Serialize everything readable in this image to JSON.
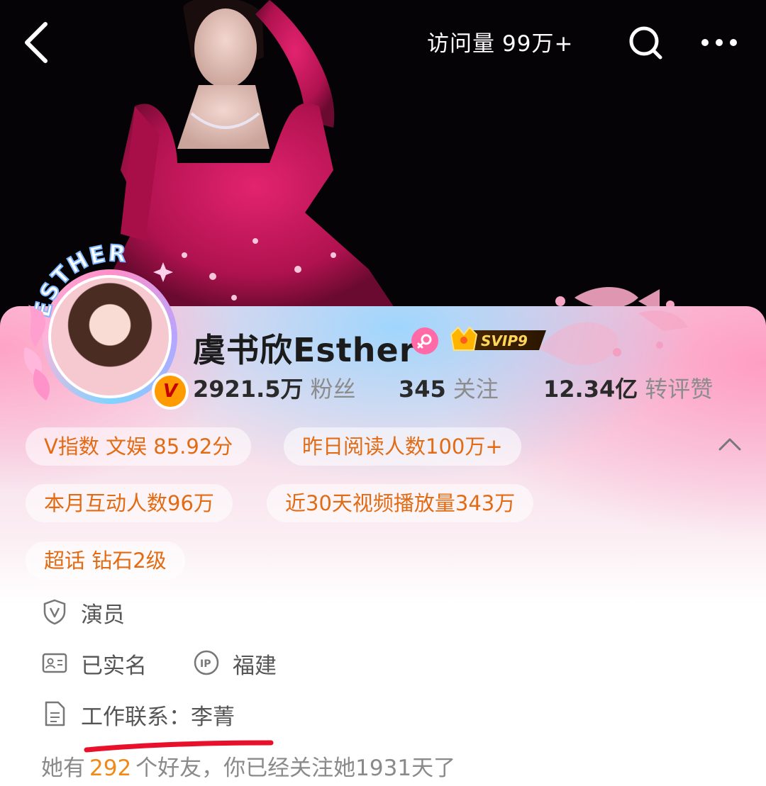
{
  "header": {
    "visits_label": "访问量",
    "visits_value": "99万+"
  },
  "profile": {
    "avatar_ring_text": "ESTHER",
    "name": "虞书欣Esther",
    "verified_badge": "V",
    "svip_badge": "SVIP9",
    "stats": [
      {
        "value": "2921.5万",
        "label": "粉丝"
      },
      {
        "value": "345",
        "label": "关注"
      },
      {
        "value": "12.34亿",
        "label": "转评赞"
      }
    ]
  },
  "chips": [
    "V指数 文娱 85.92分",
    "昨日阅读人数100万+",
    "本月互动人数96万",
    "近30天视频播放量343万",
    "超话 钻石2级"
  ],
  "info": {
    "occupation": "演员",
    "real_name": "已实名",
    "ip_location": "福建",
    "work_contact": "工作联系：李菁"
  },
  "friends": {
    "prefix": "她有",
    "count": "292",
    "suffix": "个好友，你已经关注她1931天了"
  },
  "icons": {
    "back": "chevron-left-icon",
    "search": "search-icon",
    "more": "more-icon",
    "gender": "female-icon",
    "occupation": "verified-shield-icon",
    "real_name": "id-card-icon",
    "ip": "ip-icon",
    "document": "document-icon",
    "collapse": "chevron-up-icon"
  },
  "colors": {
    "accent_orange": "#e26b13",
    "highlight": "#f08a16",
    "gender_pink": "#ff6aa7",
    "underline_red": "#e8102a"
  }
}
